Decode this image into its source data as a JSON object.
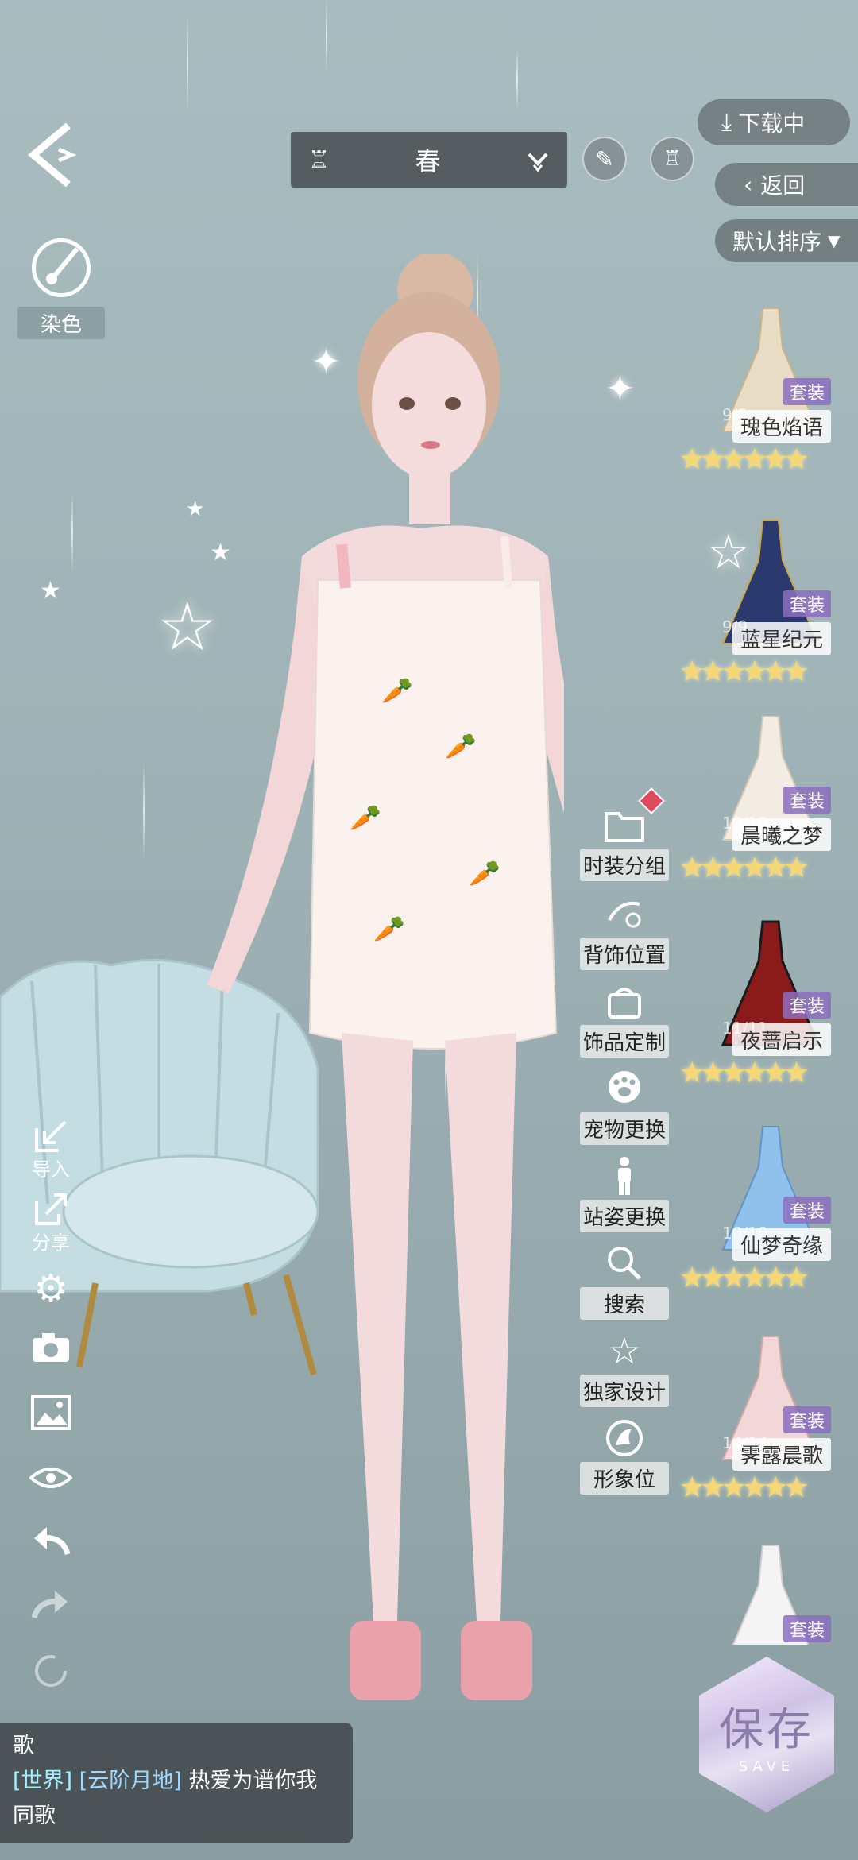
{
  "top_bar": {
    "season_label": "春",
    "dropdown_icon": "chevron-down-icon",
    "download_label": "下载中",
    "return_label": "返回",
    "sort_label": "默认排序"
  },
  "left_panel": {
    "dye_label": "染色",
    "import_label": "导入",
    "share_label": "分享"
  },
  "side_menu": [
    {
      "label": "时装分组",
      "icon": "folder-icon"
    },
    {
      "label": "背饰位置",
      "icon": "back-accessory-icon"
    },
    {
      "label": "饰品定制",
      "icon": "accessory-custom-icon"
    },
    {
      "label": "宠物更换",
      "icon": "paw-icon"
    },
    {
      "label": "站姿更换",
      "icon": "pose-icon"
    },
    {
      "label": "搜索",
      "icon": "search-icon"
    },
    {
      "label": "独家设计",
      "icon": "star-icon"
    },
    {
      "label": "形象位",
      "icon": "avatar-slot-icon"
    }
  ],
  "outfits": [
    {
      "name": "瑰色焰语",
      "count": "9/9",
      "badge": "套装",
      "stars": "★★★★★★",
      "color": "#e8dcc4"
    },
    {
      "name": "蓝星纪元",
      "count": "9/9",
      "badge": "套装",
      "stars": "★★★★★★",
      "color": "#2a3a6e"
    },
    {
      "name": "晨曦之梦",
      "count": "10/10",
      "badge": "套装",
      "stars": "★★★★★★",
      "color": "#f3ece2"
    },
    {
      "name": "夜蔷启示",
      "count": "11/11",
      "badge": "套装",
      "stars": "★★★★★★",
      "color": "#8b1a1a"
    },
    {
      "name": "仙梦奇缘",
      "count": "10/10",
      "badge": "套装",
      "stars": "★★★★★★",
      "color": "#8fc1ec"
    },
    {
      "name": "霁露晨歌",
      "count": "14/14",
      "badge": "套装",
      "stars": "★★★★★★",
      "color": "#f2d7d8"
    },
    {
      "name": "",
      "count": "",
      "badge": "套装",
      "stars": "",
      "color": "#f4f4f4"
    }
  ],
  "chat": {
    "line1": "歌",
    "channel": "[世界]",
    "sender": "[云阶月地]",
    "message": "热爱为谱你我",
    "line3": "同歌"
  },
  "save_label": "保存",
  "save_sub": "SAVE",
  "colors": {
    "background": "#a1b5b8",
    "accent": "#f7d774",
    "badge": "#8c6ebe"
  }
}
